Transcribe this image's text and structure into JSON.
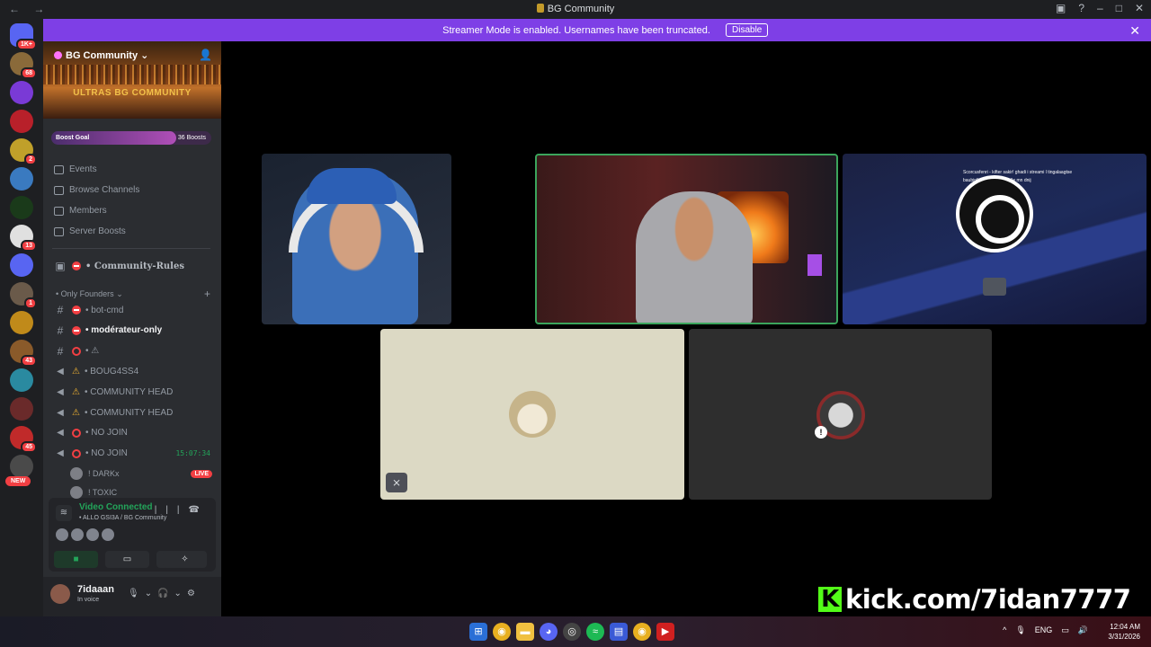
{
  "window": {
    "title": "BG Community",
    "nav": "←  →"
  },
  "banner": {
    "message": "Streamer Mode is enabled. Usernames have been truncated.",
    "disable_label": "Disable",
    "close": "✕"
  },
  "guilds": [
    {
      "badge": "1K+",
      "color": "#5865f2"
    },
    {
      "badge": "68",
      "color": "#8a6a3a"
    },
    {
      "badge": "",
      "color": "#7a3ad6"
    },
    {
      "badge": "",
      "color": "#b8202a"
    },
    {
      "badge": "2",
      "color": "#c0a02a"
    },
    {
      "badge": "",
      "color": "#3a7ac0"
    },
    {
      "badge": "",
      "color": "#1a3a1a"
    },
    {
      "badge": "13",
      "color": "#e0e0e0"
    },
    {
      "badge": "",
      "color": "#5865f2"
    },
    {
      "badge": "1",
      "color": "#6a5a4a"
    },
    {
      "badge": "",
      "color": "#c08a1a"
    },
    {
      "badge": "43",
      "color": "#8a5a2a"
    },
    {
      "badge": "",
      "color": "#2a8aa0"
    },
    {
      "badge": "",
      "color": "#6a2a2a"
    },
    {
      "badge": "45",
      "color": "#c02a2a"
    },
    {
      "badge": "",
      "color": "#4a4a4a"
    }
  ],
  "guild_new": "NEW",
  "server": {
    "name": "BG Community",
    "banner_text": "ULTRAS BG COMMUNITY",
    "boost_goal_label": "Boost Goal",
    "boost_count": "36 Boosts",
    "boost_progress": 0.78
  },
  "menu": [
    {
      "label": "Events"
    },
    {
      "label": "Browse Channels"
    },
    {
      "label": "Members"
    },
    {
      "label": "Server Boosts"
    }
  ],
  "rules_channel": "• Community-Rules",
  "category": {
    "label": "• Only Founders",
    "add": "+"
  },
  "channels": [
    {
      "type": "text",
      "prefix": "no",
      "label": "• bot-cmd",
      "time": ""
    },
    {
      "type": "text",
      "prefix": "no",
      "label": "• modérateur-only",
      "time": "",
      "active": true
    },
    {
      "type": "text",
      "prefix": "ban",
      "label": "• ⚠",
      "time": ""
    },
    {
      "type": "voice",
      "prefix": "warn",
      "label": "• BOUG4SS4",
      "time": ""
    },
    {
      "type": "voice",
      "prefix": "warn",
      "label": "• COMMUNITY HEAD",
      "time": ""
    },
    {
      "type": "voice",
      "prefix": "warn",
      "label": "• COMMUNITY HEAD",
      "time": ""
    },
    {
      "type": "voice",
      "prefix": "ban",
      "label": "• NO JOIN",
      "time": ""
    },
    {
      "type": "voice",
      "prefix": "ban",
      "label": "• NO JOIN",
      "time": "15:07:34"
    }
  ],
  "voice_users": [
    {
      "name": "! DARKx",
      "live": "LIVE"
    },
    {
      "name": "! TOXIC",
      "live": ""
    }
  ],
  "voice_panel": {
    "status": "Video Connected",
    "channel": "• ALLO GSI3A / BG Community"
  },
  "user": {
    "name": "7idaaan",
    "status": "In voice"
  },
  "overlay": {
    "kick_text": "kick.com/7idan7777"
  },
  "tile3_overlay": {
    "line1": "Scorcusfenri - kifter sakir! ghadi i streami l tingalaagtse",
    "line2": "baubin5d6e865 - ghadi 3e mn dnij"
  },
  "taskbar": {
    "tray_lang": "ENG",
    "time": "12:04 AM",
    "date": "3/31/2026"
  }
}
